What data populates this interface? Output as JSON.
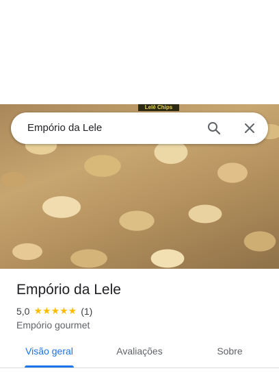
{
  "search": {
    "query": "Empório da Lele"
  },
  "hero": {
    "label": "Lelê Chips"
  },
  "place": {
    "title": "Empório da Lele",
    "rating": "5,0",
    "stars": "★★★★★",
    "review_count": "(1)",
    "category": "Empório gourmet"
  },
  "tabs": [
    {
      "label": "Visão geral",
      "active": true
    },
    {
      "label": "Avaliações",
      "active": false
    },
    {
      "label": "Sobre",
      "active": false
    }
  ],
  "colors": {
    "accent": "#1a73e8",
    "star": "#fbbc04"
  },
  "icons": {
    "search": "search-icon",
    "close": "close-icon"
  }
}
